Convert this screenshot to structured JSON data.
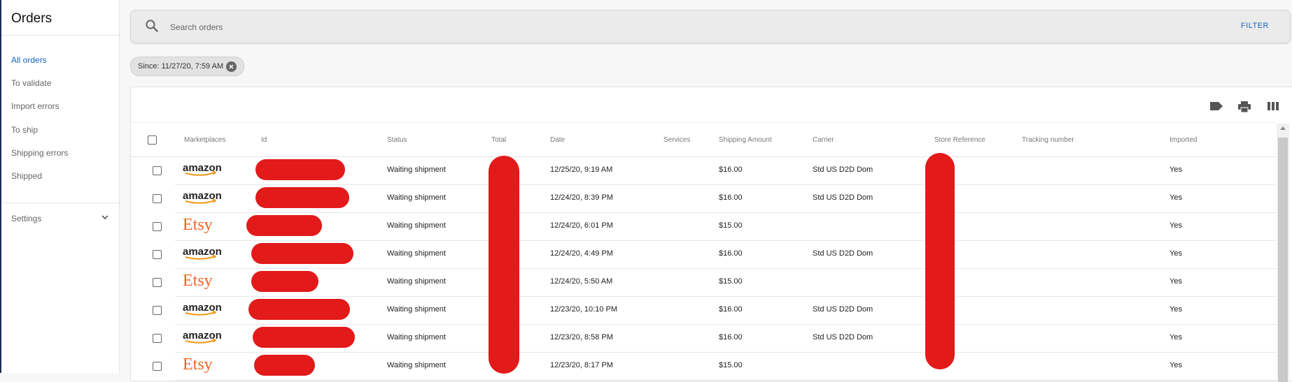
{
  "sidebar": {
    "title": "Orders",
    "items": [
      {
        "label": "All orders",
        "active": true
      },
      {
        "label": "To validate"
      },
      {
        "label": "Import errors"
      },
      {
        "label": "To ship"
      },
      {
        "label": "Shipping errors"
      },
      {
        "label": "Shipped"
      }
    ],
    "settings_label": "Settings"
  },
  "search": {
    "placeholder": "Search orders",
    "filter_label": "FILTER"
  },
  "filter_chip": {
    "label": "Since: 11/27/20, 7:59 AM"
  },
  "toolbar": {
    "icons": [
      "label-icon",
      "print-icon",
      "columns-icon"
    ]
  },
  "table": {
    "columns": [
      "Marketplaces",
      "Id",
      "Status",
      "Total",
      "Date",
      "Services",
      "Shipping Amount",
      "Carrier",
      "Store Reference",
      "Tracking number",
      "Imported"
    ],
    "rows": [
      {
        "marketplace": "amazon",
        "status": "Waiting shipment",
        "date": "12/25/20, 9:19 AM",
        "shipping_amount": "$16.00",
        "carrier": "Std US D2D Dom",
        "imported": "Yes"
      },
      {
        "marketplace": "amazon",
        "status": "Waiting shipment",
        "date": "12/24/20, 8:39 PM",
        "shipping_amount": "$16.00",
        "carrier": "Std US D2D Dom",
        "imported": "Yes"
      },
      {
        "marketplace": "Etsy",
        "status": "Waiting shipment",
        "date": "12/24/20, 6:01 PM",
        "shipping_amount": "$15.00",
        "carrier": "",
        "imported": "Yes"
      },
      {
        "marketplace": "amazon",
        "status": "Waiting shipment",
        "date": "12/24/20, 4:49 PM",
        "shipping_amount": "$16.00",
        "carrier": "Std US D2D Dom",
        "imported": "Yes"
      },
      {
        "marketplace": "Etsy",
        "status": "Waiting shipment",
        "date": "12/24/20, 5:50 AM",
        "shipping_amount": "$15.00",
        "carrier": "",
        "imported": "Yes"
      },
      {
        "marketplace": "amazon",
        "status": "Waiting shipment",
        "date": "12/23/20, 10:10 PM",
        "shipping_amount": "$16.00",
        "carrier": "Std US D2D Dom",
        "imported": "Yes"
      },
      {
        "marketplace": "amazon",
        "status": "Waiting shipment",
        "date": "12/23/20, 8:58 PM",
        "shipping_amount": "$16.00",
        "carrier": "Std US D2D Dom",
        "imported": "Yes"
      },
      {
        "marketplace": "Etsy",
        "status": "Waiting shipment",
        "date": "12/23/20, 8:17 PM",
        "shipping_amount": "$15.00",
        "carrier": "",
        "imported": "Yes"
      }
    ]
  },
  "colors": {
    "accent": "#1565c0",
    "etsy": "#f1641e",
    "redaction": "#e31a1a",
    "nav_edge": "#1c2a57"
  }
}
